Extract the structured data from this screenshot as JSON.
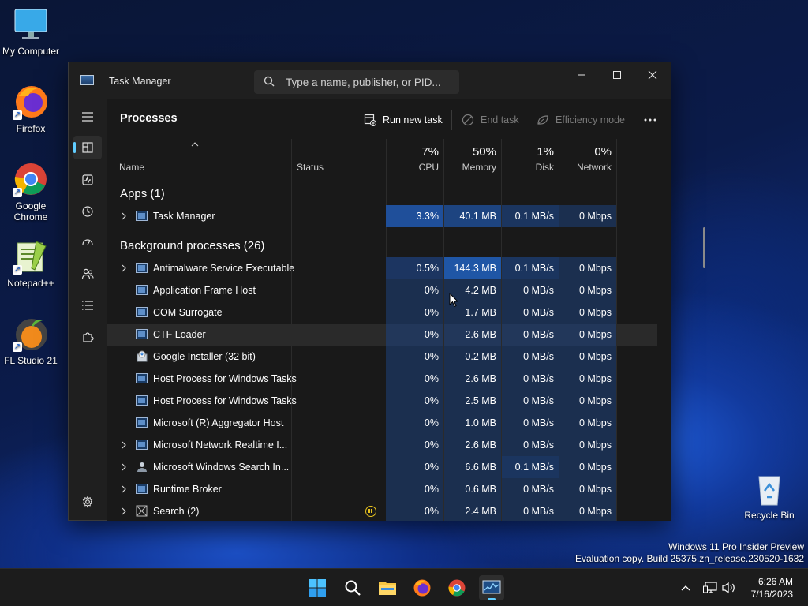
{
  "desktop": {
    "icons": [
      {
        "label": "My Computer"
      },
      {
        "label": "Firefox"
      },
      {
        "label": "Google Chrome"
      },
      {
        "label": "Notepad++"
      },
      {
        "label": "FL Studio 21"
      },
      {
        "label": "Recycle Bin"
      }
    ],
    "watermark_line1": "Windows 11 Pro Insider Preview",
    "watermark_line2": "Evaluation copy. Build 25375.zn_release.230520-1632"
  },
  "window": {
    "title": "Task Manager",
    "search_placeholder": "Type a name, publisher, or PID..."
  },
  "toolbar": {
    "page_title": "Processes",
    "run_new_task": "Run new task",
    "end_task": "End task",
    "efficiency_mode": "Efficiency mode"
  },
  "columns": {
    "name": "Name",
    "status": "Status",
    "cpu": {
      "label": "CPU",
      "pct": "7%"
    },
    "memory": {
      "label": "Memory",
      "pct": "50%"
    },
    "disk": {
      "label": "Disk",
      "pct": "1%"
    },
    "network": {
      "label": "Network",
      "pct": "0%"
    }
  },
  "groups": {
    "apps": "Apps (1)",
    "background": "Background processes (26)"
  },
  "rows": [
    {
      "name": "Task Manager",
      "cpu": "3.3%",
      "mem": "40.1 MB",
      "disk": "0.1 MB/s",
      "net": "0 Mbps"
    },
    {
      "name": "Antimalware Service Executable",
      "cpu": "0.5%",
      "mem": "144.3 MB",
      "disk": "0.1 MB/s",
      "net": "0 Mbps"
    },
    {
      "name": "Application Frame Host",
      "cpu": "0%",
      "mem": "4.2 MB",
      "disk": "0 MB/s",
      "net": "0 Mbps"
    },
    {
      "name": "COM Surrogate",
      "cpu": "0%",
      "mem": "1.7 MB",
      "disk": "0 MB/s",
      "net": "0 Mbps"
    },
    {
      "name": "CTF Loader",
      "cpu": "0%",
      "mem": "2.6 MB",
      "disk": "0 MB/s",
      "net": "0 Mbps"
    },
    {
      "name": "Google Installer (32 bit)",
      "cpu": "0%",
      "mem": "0.2 MB",
      "disk": "0 MB/s",
      "net": "0 Mbps"
    },
    {
      "name": "Host Process for Windows Tasks",
      "cpu": "0%",
      "mem": "2.6 MB",
      "disk": "0 MB/s",
      "net": "0 Mbps"
    },
    {
      "name": "Host Process for Windows Tasks",
      "cpu": "0%",
      "mem": "2.5 MB",
      "disk": "0 MB/s",
      "net": "0 Mbps"
    },
    {
      "name": "Microsoft (R) Aggregator Host",
      "cpu": "0%",
      "mem": "1.0 MB",
      "disk": "0 MB/s",
      "net": "0 Mbps"
    },
    {
      "name": "Microsoft Network Realtime I...",
      "cpu": "0%",
      "mem": "2.6 MB",
      "disk": "0 MB/s",
      "net": "0 Mbps"
    },
    {
      "name": "Microsoft Windows Search In...",
      "cpu": "0%",
      "mem": "6.6 MB",
      "disk": "0.1 MB/s",
      "net": "0 Mbps"
    },
    {
      "name": "Runtime Broker",
      "cpu": "0%",
      "mem": "0.6 MB",
      "disk": "0 MB/s",
      "net": "0 Mbps"
    },
    {
      "name": "Search (2)",
      "cpu": "0%",
      "mem": "2.4 MB",
      "disk": "0 MB/s",
      "net": "0 Mbps"
    }
  ],
  "taskbar": {
    "time": "6:26 AM",
    "date": "7/16/2023"
  },
  "colors": {
    "accent": "#60cdff",
    "heat_low": "#1b2f4f",
    "heat_mid": "#1d4480",
    "heat_high": "#1f56a6"
  }
}
